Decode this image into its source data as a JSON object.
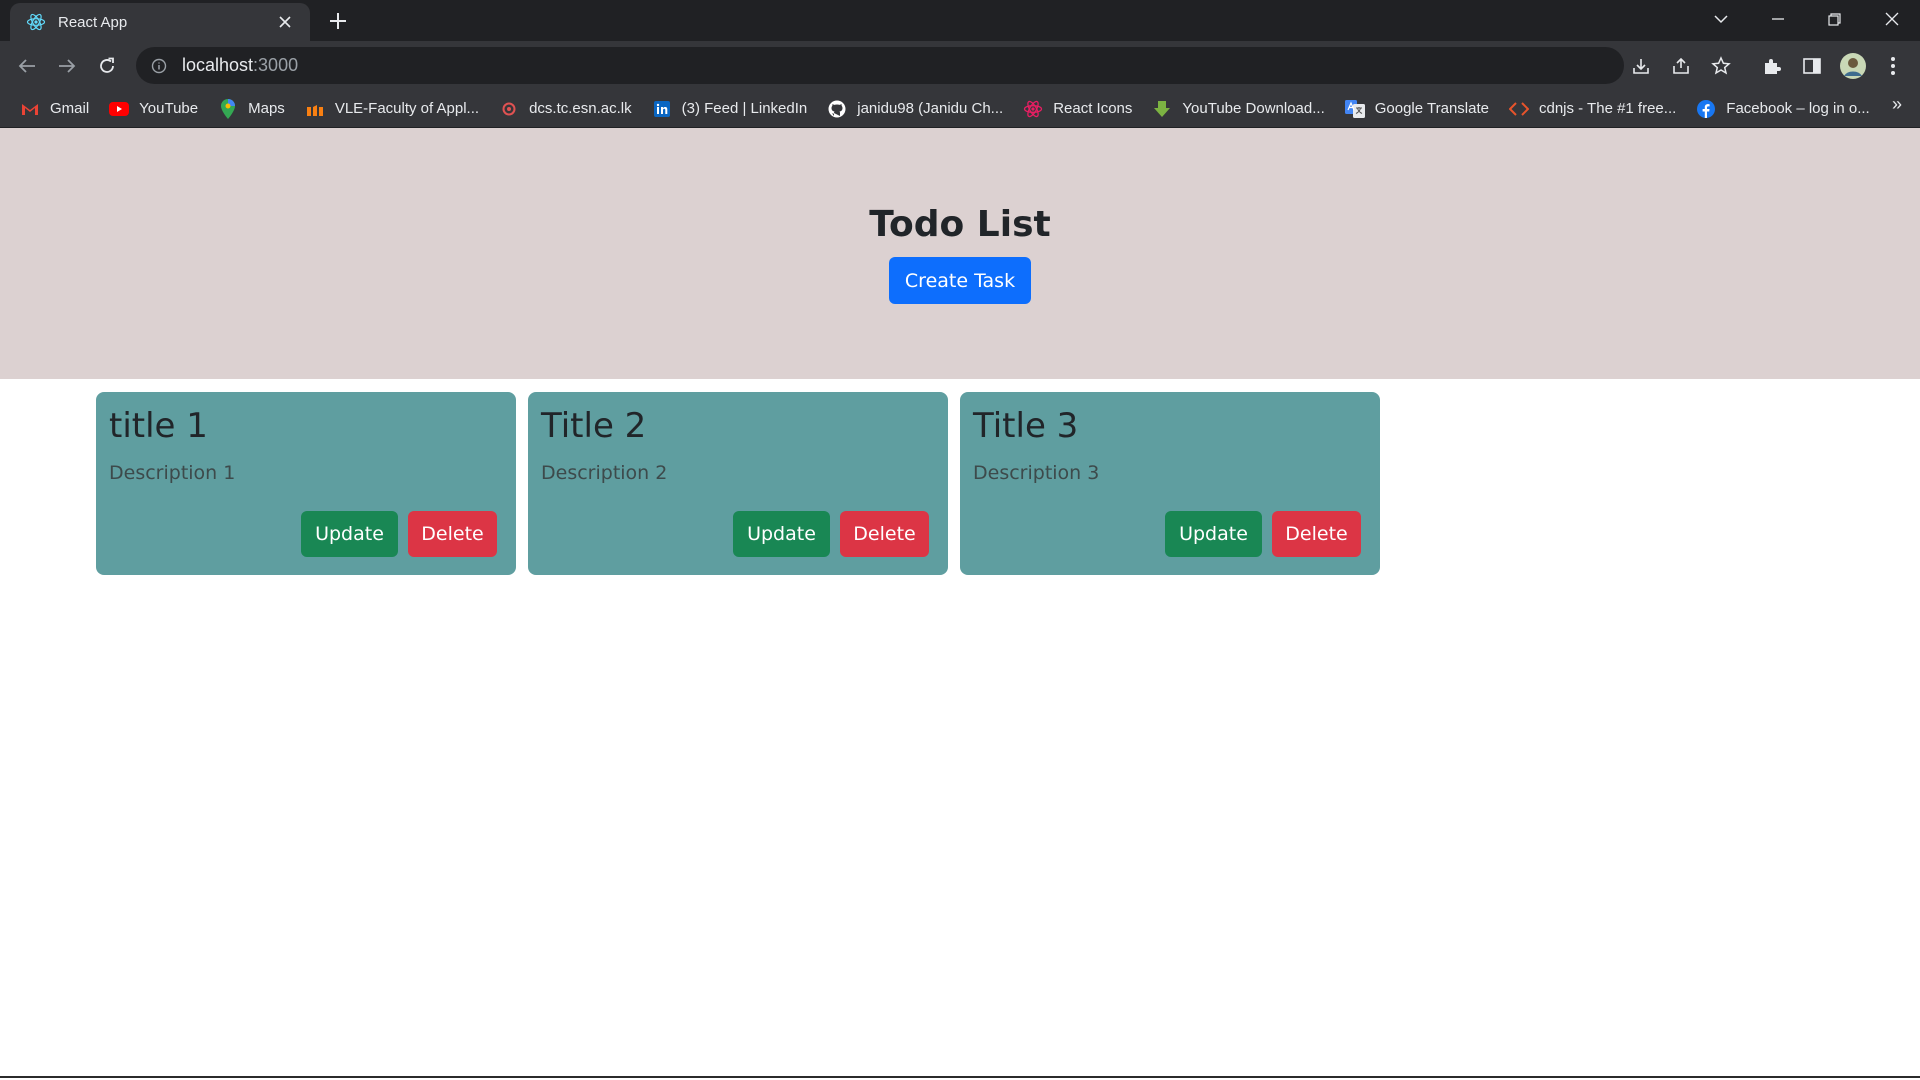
{
  "browser": {
    "tab_title": "React App",
    "url_host": "localhost",
    "url_port": ":3000",
    "bookmarks": [
      {
        "label": "Gmail",
        "icon": "gmail-icon"
      },
      {
        "label": "YouTube",
        "icon": "youtube-icon"
      },
      {
        "label": "Maps",
        "icon": "maps-icon"
      },
      {
        "label": "VLE-Faculty of Appl...",
        "icon": "vle-icon"
      },
      {
        "label": "dcs.tc.esn.ac.lk",
        "icon": "dcs-icon"
      },
      {
        "label": "(3) Feed | LinkedIn",
        "icon": "linkedin-icon"
      },
      {
        "label": "janidu98 (Janidu Ch...",
        "icon": "github-icon"
      },
      {
        "label": "React Icons",
        "icon": "react-icons-icon"
      },
      {
        "label": "YouTube Download...",
        "icon": "download-arrow-icon"
      },
      {
        "label": "Google Translate",
        "icon": "translate-icon"
      },
      {
        "label": "cdnjs - The #1 free...",
        "icon": "code-brackets-icon"
      },
      {
        "label": "Facebook – log in o...",
        "icon": "facebook-icon"
      }
    ],
    "bookmarks_more": "»"
  },
  "page": {
    "title": "Todo List",
    "create_label": "Create Task",
    "tasks": [
      {
        "title": "title 1",
        "description": "Description 1",
        "update_label": "Update",
        "delete_label": "Delete"
      },
      {
        "title": "Title 2",
        "description": "Description 2",
        "update_label": "Update",
        "delete_label": "Delete"
      },
      {
        "title": "Title 3",
        "description": "Description 3",
        "update_label": "Update",
        "delete_label": "Delete"
      }
    ]
  },
  "colors": {
    "header_band": "#dcd1d1",
    "card": "#5f9ea0",
    "primary": "#0d6efd",
    "success": "#198754",
    "danger": "#dc3545"
  }
}
